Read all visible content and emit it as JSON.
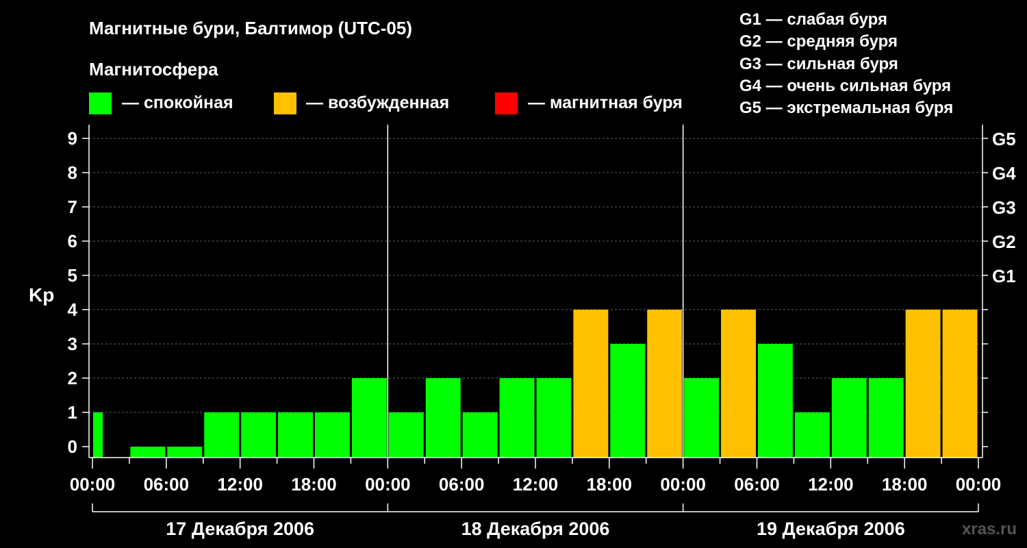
{
  "chart_data": {
    "type": "bar",
    "title": "Магнитные бури, Балтимор (UTC-05)",
    "legend_title": "Магнитосфера",
    "legend": [
      {
        "label": "— спокойная",
        "color": "#00ff00"
      },
      {
        "label": "— возбужденная",
        "color": "#ffc000"
      },
      {
        "label": "— магнитная буря",
        "color": "#ff0000"
      }
    ],
    "g_legend": [
      "G1 — слабая буря",
      "G2 — средняя буря",
      "G3 — сильная буря",
      "G4 — очень сильная буря",
      "G5 — экстремальная буря"
    ],
    "ylabel": "Kp",
    "ylim": [
      0,
      9
    ],
    "y_ticks": [
      "0",
      "1",
      "2",
      "3",
      "4",
      "5",
      "6",
      "7",
      "8",
      "9"
    ],
    "g_ticks": [
      {
        "kp": 5,
        "label": "G1"
      },
      {
        "kp": 6,
        "label": "G2"
      },
      {
        "kp": 7,
        "label": "G3"
      },
      {
        "kp": 8,
        "label": "G4"
      },
      {
        "kp": 9,
        "label": "G5"
      }
    ],
    "x_tick_labels": [
      "00:00",
      "06:00",
      "12:00",
      "18:00",
      "00:00",
      "06:00",
      "12:00",
      "18:00",
      "00:00",
      "06:00",
      "12:00",
      "18:00",
      "00:00"
    ],
    "days": [
      "17 Декабря 2006",
      "18 Декабря 2006",
      "19 Декабря 2006"
    ],
    "bar_start_hours": [
      0,
      3,
      6,
      9,
      12,
      15,
      18,
      21,
      24,
      27,
      30,
      33,
      36,
      39,
      42,
      45,
      48,
      51,
      54,
      57,
      60,
      63,
      66,
      69
    ],
    "first_bar_start_hour": 0,
    "first_bar_partial": true,
    "values": [
      1,
      0,
      0,
      1,
      1,
      1,
      1,
      2,
      1,
      2,
      1,
      2,
      2,
      4,
      3,
      4,
      2,
      4,
      3,
      1,
      2,
      2,
      4,
      4
    ],
    "colors": {
      "quiet": "#00ff00",
      "active": "#ffc000",
      "storm": "#ff0000"
    },
    "grid": true,
    "watermark": "xras.ru"
  }
}
